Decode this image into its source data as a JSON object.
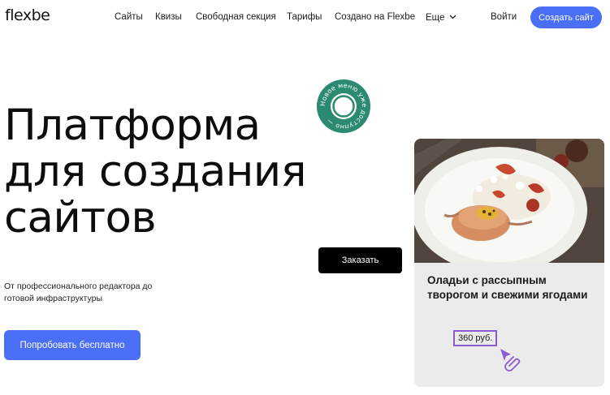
{
  "header": {
    "logo": "flexbe",
    "nav": [
      {
        "label": "Сайты"
      },
      {
        "label": "Квизы"
      },
      {
        "label": "Свободная секция"
      },
      {
        "label": "Тарифы"
      },
      {
        "label": "Создано на Flexbe"
      },
      {
        "label": "Еще"
      }
    ],
    "login": "Войти",
    "create_button": "Создать сайт"
  },
  "hero": {
    "title_lines": [
      "Платформа",
      "для создания",
      "сайтов"
    ],
    "subtitle": "От профессионального редактора до готовой инфраструктуры",
    "try_button": "Попробовать бесплатно",
    "badge_text": "Новое меню уже доступно —"
  },
  "order_button": "Заказать",
  "card": {
    "title": "Оладьи с рассыпным творогом и свежими ягодами",
    "price": "360 руб."
  },
  "colors": {
    "accent": "#4a6ef6",
    "badge_green": "#2c8a72",
    "price_outline": "#8a5ccf",
    "cursor": "#8a5ccf"
  },
  "icons": {
    "more": "chevron-down-icon",
    "cursor": "paperclip-pointer-icon"
  }
}
